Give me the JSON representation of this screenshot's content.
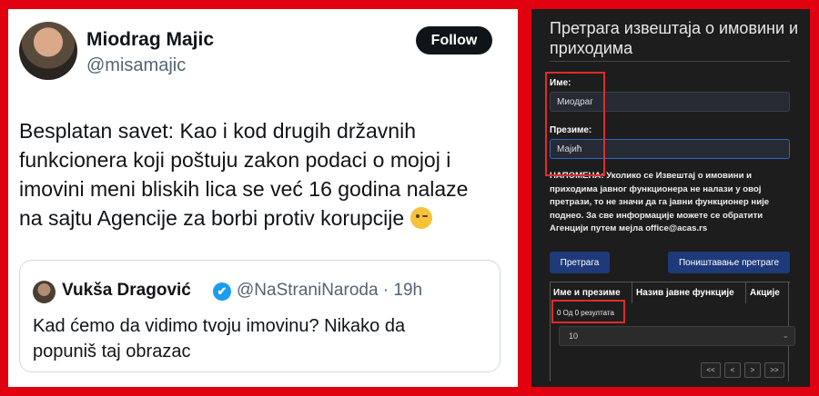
{
  "tweet": {
    "author_name": "Miodrag Majic",
    "author_handle": "@misamajic",
    "follow_label": "Follow",
    "text_lines": [
      "Besplatan savet: Kao i kod drugih državnih",
      "funkcionera koji poštuju zakon podaci o mojoj i",
      "imovini meni bliskih lica se već 16 godina nalaze",
      "na sajtu Agencije za borbi protiv korupcije"
    ],
    "quote": {
      "author_name": "Vukša Dragović",
      "verified_mark": "✔",
      "author_handle": "@NaStraniNaroda · 19h",
      "text_lines": [
        "Kad ćemo da vidimo tvoju imovinu? Nikako da",
        "popuniš taj obrazac"
      ]
    }
  },
  "search": {
    "title": "Претрага извештаја о имовини и приходима",
    "first_name_label": "Име:",
    "first_name_value": "Миодраг",
    "last_name_label": "Презиме:",
    "last_name_value": "Мајић",
    "note": "НАПОМЕНА: Уколико се Извештај о имовини и приходима јавног функционера не налази у овој претрази, то не значи да га јавни функционер није поднео. За све информације можете се обратити Агенцији путем мејла office@acas.rs",
    "search_button": "Претрага",
    "reset_button": "Поништавање претраге",
    "columns": [
      "Име и презиме",
      "Назив јавне функције",
      "Акције"
    ],
    "results_info": "0 Од 0 резултата",
    "page_size": "10",
    "pager": [
      "<<",
      "<",
      ">",
      ">>"
    ]
  },
  "colors": {
    "frame": "#e0000f",
    "highlight": "#e02b2b",
    "panel_bg": "#1d1d1d",
    "button_bg": "#1e3a7a"
  }
}
